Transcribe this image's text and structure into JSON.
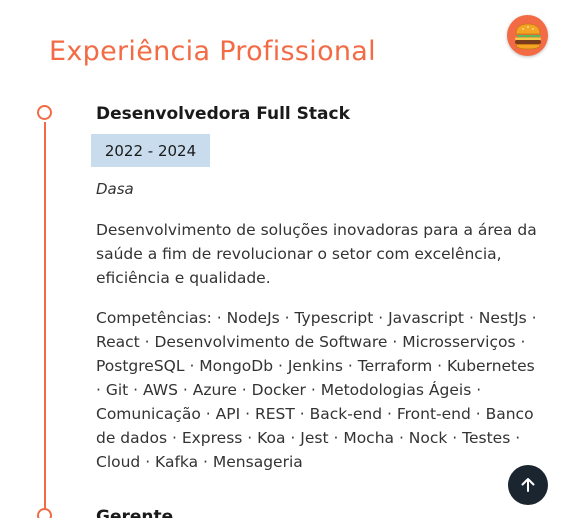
{
  "section": {
    "title": "Experiência Profissional"
  },
  "header": {
    "menu_icon": "burger-icon",
    "menu_button_color": "#f26b45"
  },
  "colors": {
    "accent": "#f26b45",
    "period_badge_bg": "#c8dced",
    "scroll_top_bg": "#1b2530"
  },
  "experiences": [
    {
      "title": "Desenvolvedora Full Stack",
      "period": "2022 - 2024",
      "company": "Dasa",
      "description": "Desenvolvimento de soluções inovadoras para a área da saúde a fim de revolucionar o setor com excelência, eficiência e qualidade.",
      "skills": "Competências: · NodeJs · Typescript · Javascript · NestJs · React · Desenvolvimento de Software · Microsserviços · PostgreSQL · MongoDb · Jenkins · Terraform · Kubernetes · Git · AWS · Azure · Docker · Metodologias Ágeis · Comunicação · API · REST · Back-end · Front-end · Banco de dados · Express · Koa · Jest · Mocha · Nock · Testes · Cloud · Kafka · Mensageria"
    },
    {
      "title": "Gerente"
    }
  ],
  "scroll_top": {
    "icon": "arrow-up-icon"
  }
}
